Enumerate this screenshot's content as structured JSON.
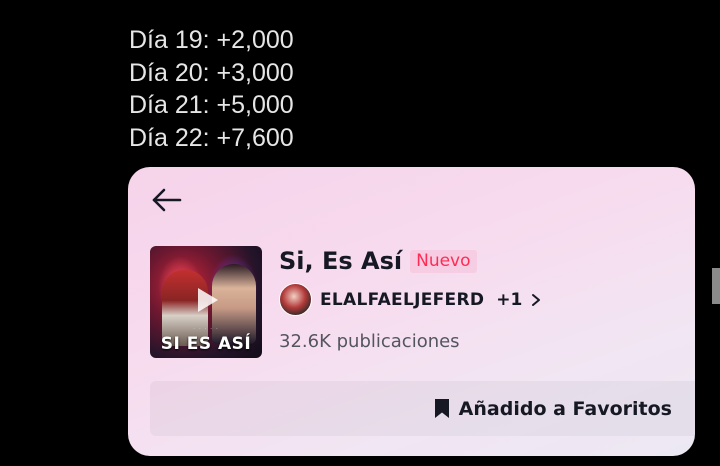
{
  "stats_lines": [
    "Día 19: +2,000",
    "Día 20: +3,000",
    "Día 21: +5,000",
    "Día 22: +7,600"
  ],
  "sound_card": {
    "back_icon": "arrow-left-icon",
    "album": {
      "cover_title": "SI ES ASÍ",
      "play_icon": "play-icon"
    },
    "title": "Si, Es Así",
    "badge": "Nuevo",
    "artist": {
      "name": "ELALFAELJEFERD",
      "more": "+1",
      "chevron_icon": "chevron-right-icon"
    },
    "posts": "32.6K publicaciones",
    "favorite_button": {
      "icon": "bookmark-filled-icon",
      "label": "Añadido a Favoritos"
    }
  },
  "colors": {
    "background": "#000000",
    "stats_text": "#e6e6e6",
    "card_pink": "#f6d3ea",
    "badge_red": "#fe2c55",
    "primary_text": "#161823",
    "secondary_text": "#545560"
  }
}
